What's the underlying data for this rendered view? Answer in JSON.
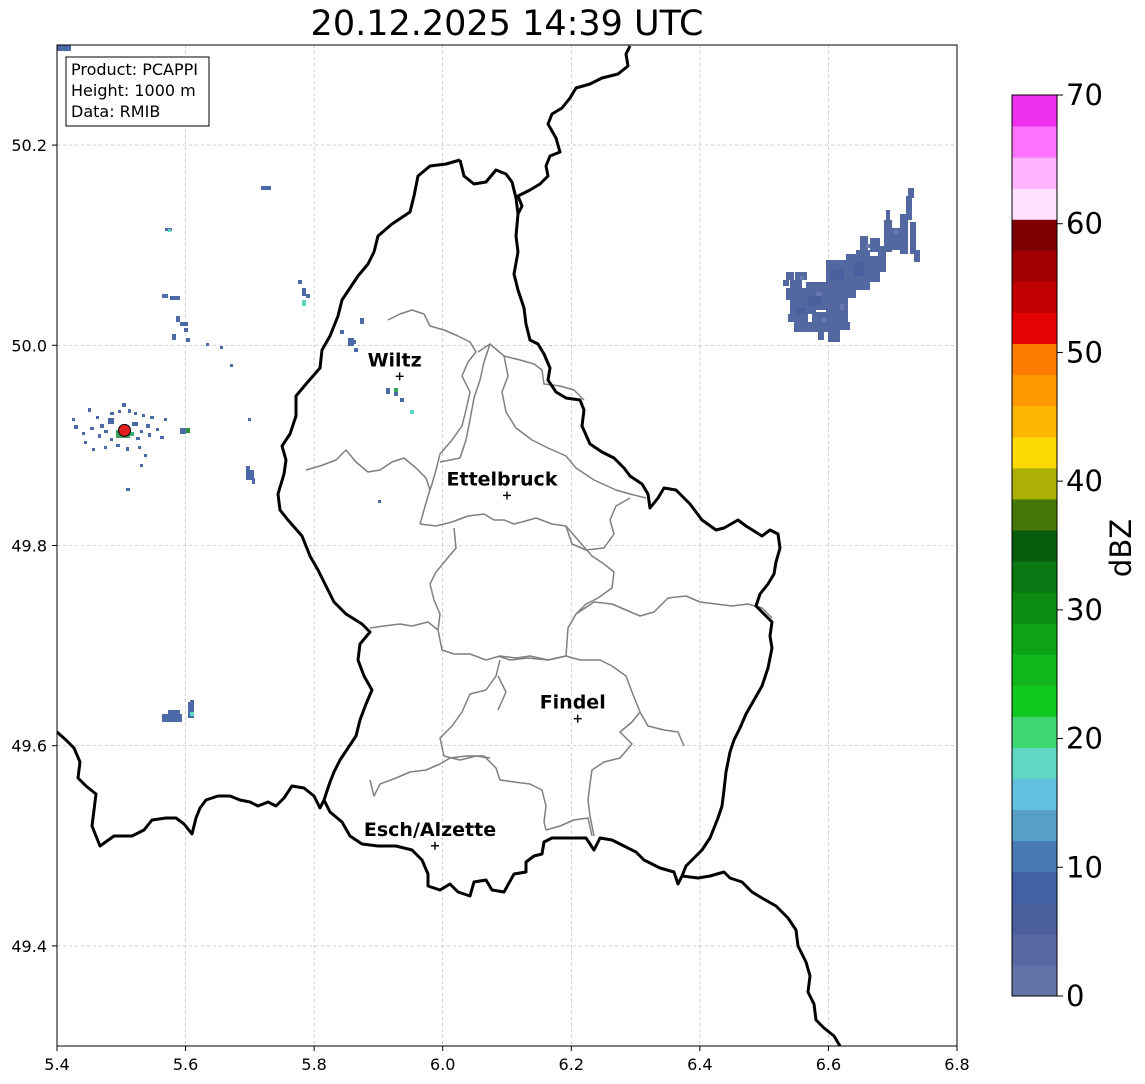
{
  "title": "20.12.2025 14:39 UTC",
  "info_box": {
    "product": "Product: PCAPPI",
    "height": "Height: 1000 m",
    "data": "Data: RMIB"
  },
  "map": {
    "lon_range": [
      5.4,
      6.8
    ],
    "lat_range": [
      49.3,
      50.3
    ],
    "x_ticks": [
      5.4,
      5.6,
      5.8,
      6.0,
      6.2,
      6.4,
      6.6,
      6.8
    ],
    "x_tick_labels": [
      "5.4",
      "5.6",
      "5.8",
      "6.0",
      "6.2",
      "6.4",
      "6.6",
      "6.8"
    ],
    "y_ticks": [
      49.4,
      49.6,
      49.8,
      50.0,
      50.2
    ],
    "y_tick_labels": [
      "49.4",
      "49.6",
      "49.8",
      "50.0",
      "50.2"
    ],
    "grid": true
  },
  "cities": [
    {
      "name": "Wiltz",
      "lon": 5.933,
      "lat": 49.969
    },
    {
      "name": "Ettelbruck",
      "lon": 6.1,
      "lat": 49.85
    },
    {
      "name": "Findel",
      "lon": 6.21,
      "lat": 49.627
    },
    {
      "name": "Esch/Alzette",
      "lon": 5.988,
      "lat": 49.5
    }
  ],
  "radar_site": {
    "lon": 5.505,
    "lat": 49.915
  },
  "colorbar": {
    "label": "dBZ",
    "min": 0,
    "max": 70,
    "tick_values": [
      0,
      10,
      20,
      30,
      40,
      50,
      60,
      70
    ],
    "tick_labels": [
      "0",
      "10",
      "20",
      "30",
      "40",
      "50",
      "60",
      "70"
    ],
    "colors": [
      "#6373a7",
      "#5868a0",
      "#4b5f9e",
      "#4160a5",
      "#4a7ab4",
      "#589fc8",
      "#62c1de",
      "#5ed7c3",
      "#3ed673",
      "#10c81e",
      "#12b81b",
      "#0ea316",
      "#0c8d12",
      "#097812",
      "#075c0b",
      "#457708",
      "#acb005",
      "#fcd900",
      "#fcb800",
      "#fc9a00",
      "#fc7c00",
      "#e40202",
      "#c00000",
      "#a20000",
      "#7d0000",
      "#ffe1ff",
      "#ffb4ff",
      "#ff73ff",
      "#ee30ee"
    ]
  }
}
